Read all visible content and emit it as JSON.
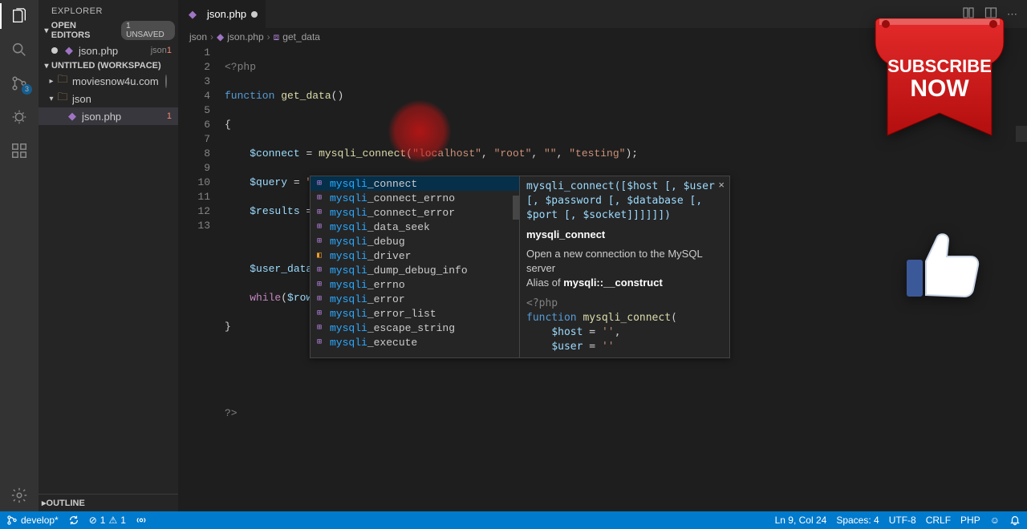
{
  "sidebar": {
    "title": "EXPLORER",
    "openEditorsLabel": "OPEN EDITORS",
    "unsavedBadge": "1 UNSAVED",
    "workspaceLabel": "UNTITLED (WORKSPACE)",
    "outlineLabel": "OUTLINE",
    "openEditors": [
      {
        "name": "json.php",
        "dir": "json",
        "errors": "1",
        "dirty": true
      }
    ],
    "tree": [
      {
        "name": "moviesnow4u.com",
        "type": "folder",
        "dirty": true,
        "depth": 1
      },
      {
        "name": "json",
        "type": "folder",
        "depth": 1,
        "expanded": true
      },
      {
        "name": "json.php",
        "type": "file",
        "errors": "1",
        "depth": 2,
        "active": true
      }
    ]
  },
  "activity": {
    "scmBadge": "3"
  },
  "tab": {
    "icon": "php",
    "name": "json.php",
    "dirty": true
  },
  "breadcrumbs": {
    "p1": "json",
    "p2": "json.php",
    "p3": "get_data"
  },
  "code": {
    "lines": 13
  },
  "autocomplete": {
    "items": [
      {
        "label": "mysqli_connect",
        "kind": "fn",
        "selected": true
      },
      {
        "label": "mysqli_connect_errno",
        "kind": "fn"
      },
      {
        "label": "mysqli_connect_error",
        "kind": "fn"
      },
      {
        "label": "mysqli_data_seek",
        "kind": "fn"
      },
      {
        "label": "mysqli_debug",
        "kind": "fn"
      },
      {
        "label": "mysqli_driver",
        "kind": "cls"
      },
      {
        "label": "mysqli_dump_debug_info",
        "kind": "fn"
      },
      {
        "label": "mysqli_errno",
        "kind": "fn"
      },
      {
        "label": "mysqli_error",
        "kind": "fn"
      },
      {
        "label": "mysqli_error_list",
        "kind": "fn"
      },
      {
        "label": "mysqli_escape_string",
        "kind": "fn"
      },
      {
        "label": "mysqli_execute",
        "kind": "fn"
      }
    ],
    "matchPrefix": "mysqli",
    "doc": {
      "signature": "mysqli_connect([$host [, $user [, $password [, $database [, $port [, $socket]]]]]])",
      "title": "mysqli_connect",
      "desc": "Open a new connection to the MySQL server",
      "aliasPrefix": "Alias of ",
      "aliasBold": "mysqli::__construct",
      "snippet_open": "<?php",
      "snippet_kw": "function",
      "snippet_fn": "mysqli_connect",
      "snippet_l1v": "$host",
      "snippet_l1s": "''",
      "snippet_l2v": "$user",
      "snippet_l2s": "''"
    }
  },
  "statusbar": {
    "branch": "develop*",
    "errors": "1",
    "warnings": "1",
    "cursor": "Ln 9, Col 24",
    "spaces": "Spaces: 4",
    "encoding": "UTF-8",
    "eol": "CRLF",
    "language": "PHP",
    "feedback": "☺"
  },
  "overlay": {
    "subscribe_l1": "SUBSCRIBE",
    "subscribe_l2": "NOW"
  }
}
